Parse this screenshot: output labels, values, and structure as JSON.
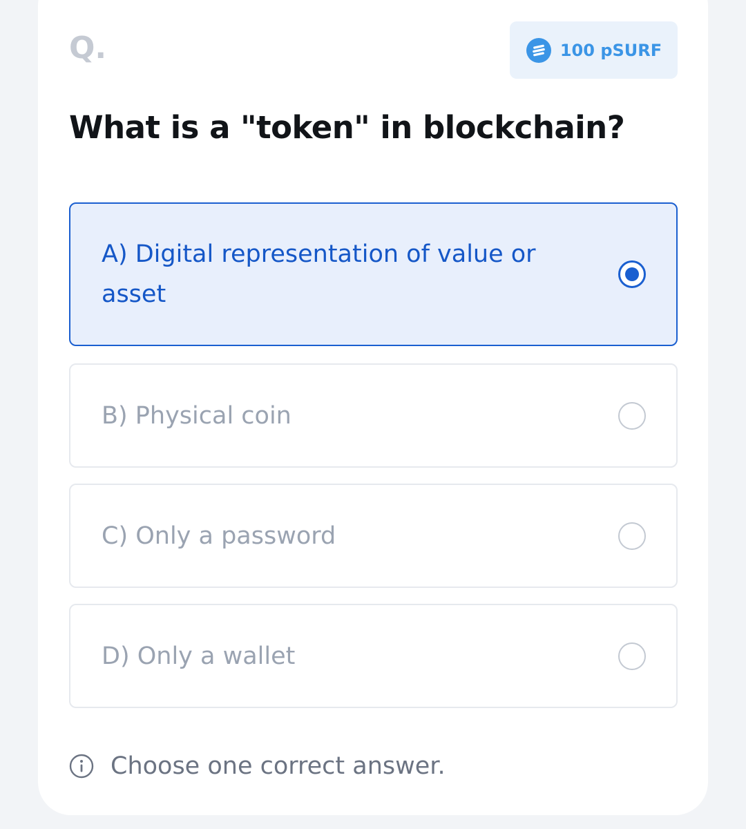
{
  "quiz": {
    "q_label": "Q.",
    "reward": {
      "icon": "token-coin-icon",
      "text": "100 pSURF"
    },
    "question": "What is a \"token\" in blockchain?",
    "options": [
      {
        "label": "A) Digital representation of value or asset",
        "selected": true
      },
      {
        "label": "B) Physical coin",
        "selected": false
      },
      {
        "label": "C) Only a password",
        "selected": false
      },
      {
        "label": "D) Only a wallet",
        "selected": false
      }
    ],
    "hint": {
      "icon": "info-icon",
      "text": "Choose one correct answer."
    }
  },
  "colors": {
    "accent": "#1a5fd0",
    "selected_bg": "#e8effc",
    "reward_text": "#3b95e6",
    "reward_bg": "#eaf2fb"
  }
}
